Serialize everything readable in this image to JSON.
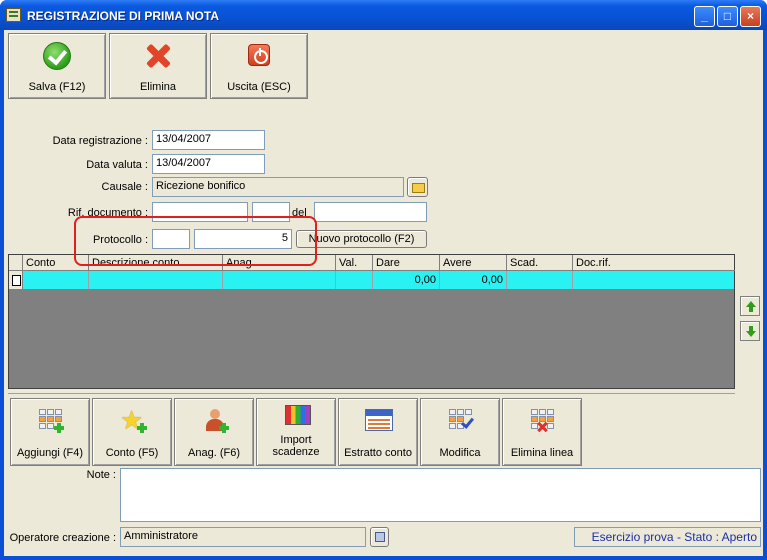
{
  "window": {
    "title": "REGISTRAZIONE DI PRIMA NOTA"
  },
  "toolbar": {
    "save_label": "Salva (F12)",
    "delete_label": "Elimina",
    "exit_label": "Uscita (ESC)"
  },
  "form": {
    "data_registrazione": {
      "label": "Data registrazione :",
      "value": "13/04/2007"
    },
    "data_valuta": {
      "label": "Data valuta :",
      "value": "13/04/2007"
    },
    "causale": {
      "label": "Causale :",
      "value": "Ricezione bonifico"
    },
    "rif_documento": {
      "label": "Rif. documento :",
      "value1": "",
      "value2": "",
      "del_label": "del",
      "del_value": ""
    },
    "protocollo": {
      "label": "Protocollo :",
      "prefix": "",
      "number": "5",
      "button_label": "Nuovo protocollo (F2)"
    }
  },
  "grid": {
    "columns": [
      "Conto",
      "Descrizione conto",
      "Anag.",
      "Val.",
      "Dare",
      "Avere",
      "Scad.",
      "Doc.rif."
    ],
    "rows": [
      {
        "conto": "",
        "descrizione": "",
        "anag": "",
        "val": "",
        "dare": "0,00",
        "avere": "0,00",
        "scad": "",
        "docrif": ""
      }
    ]
  },
  "actions": {
    "aggiungi": "Aggiungi (F4)",
    "conto": "Conto (F5)",
    "anag": "Anag. (F6)",
    "import_line1": "Import",
    "import_line2": "scadenze",
    "estratto": "Estratto conto",
    "modifica": "Modifica",
    "elimina_linea": "Elimina linea"
  },
  "note": {
    "label": "Note :",
    "value": ""
  },
  "footer": {
    "operatore_label": "Operatore creazione :",
    "operatore_value": "Amministratore",
    "status": "Esercizio prova - Stato : Aperto"
  },
  "colors": {
    "titlebar": "#0a59e0",
    "grid_row": "#2bf2f2",
    "highlight": "#e0201c",
    "status_text": "#1a2ea8"
  }
}
